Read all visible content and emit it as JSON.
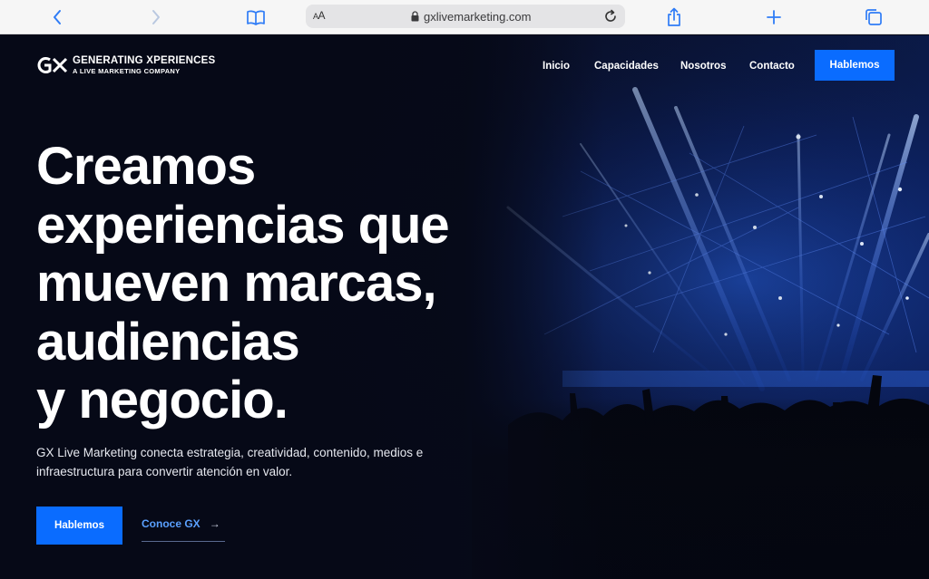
{
  "browser": {
    "text_size_label": "AA",
    "url": "gxlivemarketing.com",
    "icons": [
      "back-icon",
      "forward-icon",
      "bookmarks-icon",
      "lock-icon",
      "reload-icon",
      "share-icon",
      "new-tab-icon",
      "tabs-icon"
    ]
  },
  "site": {
    "brand": {
      "title": "GENERATING XPERIENCES",
      "subtitle": "A LIVE MARKETING COMPANY",
      "logo_text": "GX"
    },
    "nav": {
      "links": [
        "Inicio",
        "Capacidades",
        "Nosotros",
        "Contacto"
      ],
      "cta": "Hablemos"
    },
    "hero": {
      "headline_lines": [
        "Creamos",
        "experiencias que",
        "mueven marcas,",
        "audiencias",
        "y negocio."
      ],
      "lede": "GX Live Marketing conecta estrategia, creatividad, contenido, medios e infraestructura para convertir atención en valor.",
      "primary_button": "Hablemos",
      "secondary_link": "Conoce GX",
      "secondary_arrow": "→"
    },
    "colors": {
      "accent": "#0a6cff",
      "link": "#5aa0ff",
      "background": "#070a18"
    }
  }
}
